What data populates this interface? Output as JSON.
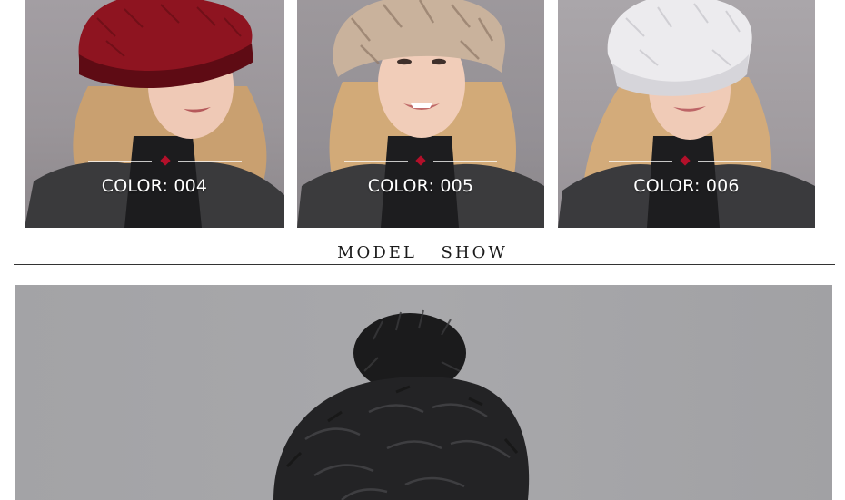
{
  "color_cards": [
    {
      "label": "COLOR: 004",
      "hat_color": "#8e1420",
      "hat_shade": "#5e0b14"
    },
    {
      "label": "COLOR: 005",
      "hat_color": "#c9b29c",
      "hat_shade": "#8f7866"
    },
    {
      "label": "COLOR: 006",
      "hat_color": "#ecebee",
      "hat_shade": "#c9c8cd"
    }
  ],
  "section": {
    "title": "MODEL  SHOW"
  },
  "colors": {
    "accent_diamond": "#b3102a",
    "rule": "#333333"
  }
}
